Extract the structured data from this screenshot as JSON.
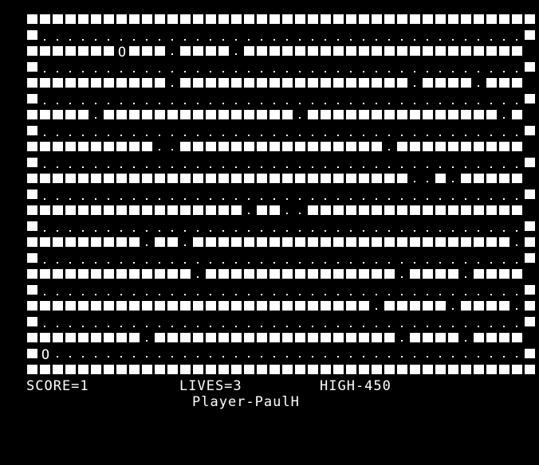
{
  "game": {
    "colors": {
      "background": "#000000",
      "foreground": "#ffffff"
    },
    "legend": {
      "#": "wall-block",
      ".": "dot",
      "O": "ball-token"
    },
    "maze": [
      "########################################",
      "#......................................#",
      "#######O###.####.######################",
      "#......................................#",
      "###########.##################.####.###",
      "#......................................#",
      "#####.###############.###############.#",
      "#......................................#",
      "##########..################.##########",
      "#......................................#",
      "##############################..#.#####",
      "#......................................#",
      "#################.##..#################",
      "#......................................#",
      "#########.##.#########################.#",
      "#......................................#",
      "#############.###############.####.####",
      "#......................................#",
      "###########################.#####.####.#",
      "#......................................#",
      "#########.###################.####.####",
      "#O.....................................#",
      "########################################"
    ]
  },
  "status": {
    "score": "SCORE=1",
    "lives": "LIVES=3",
    "high": "HIGH-450",
    "player": "Player-PaulH"
  }
}
